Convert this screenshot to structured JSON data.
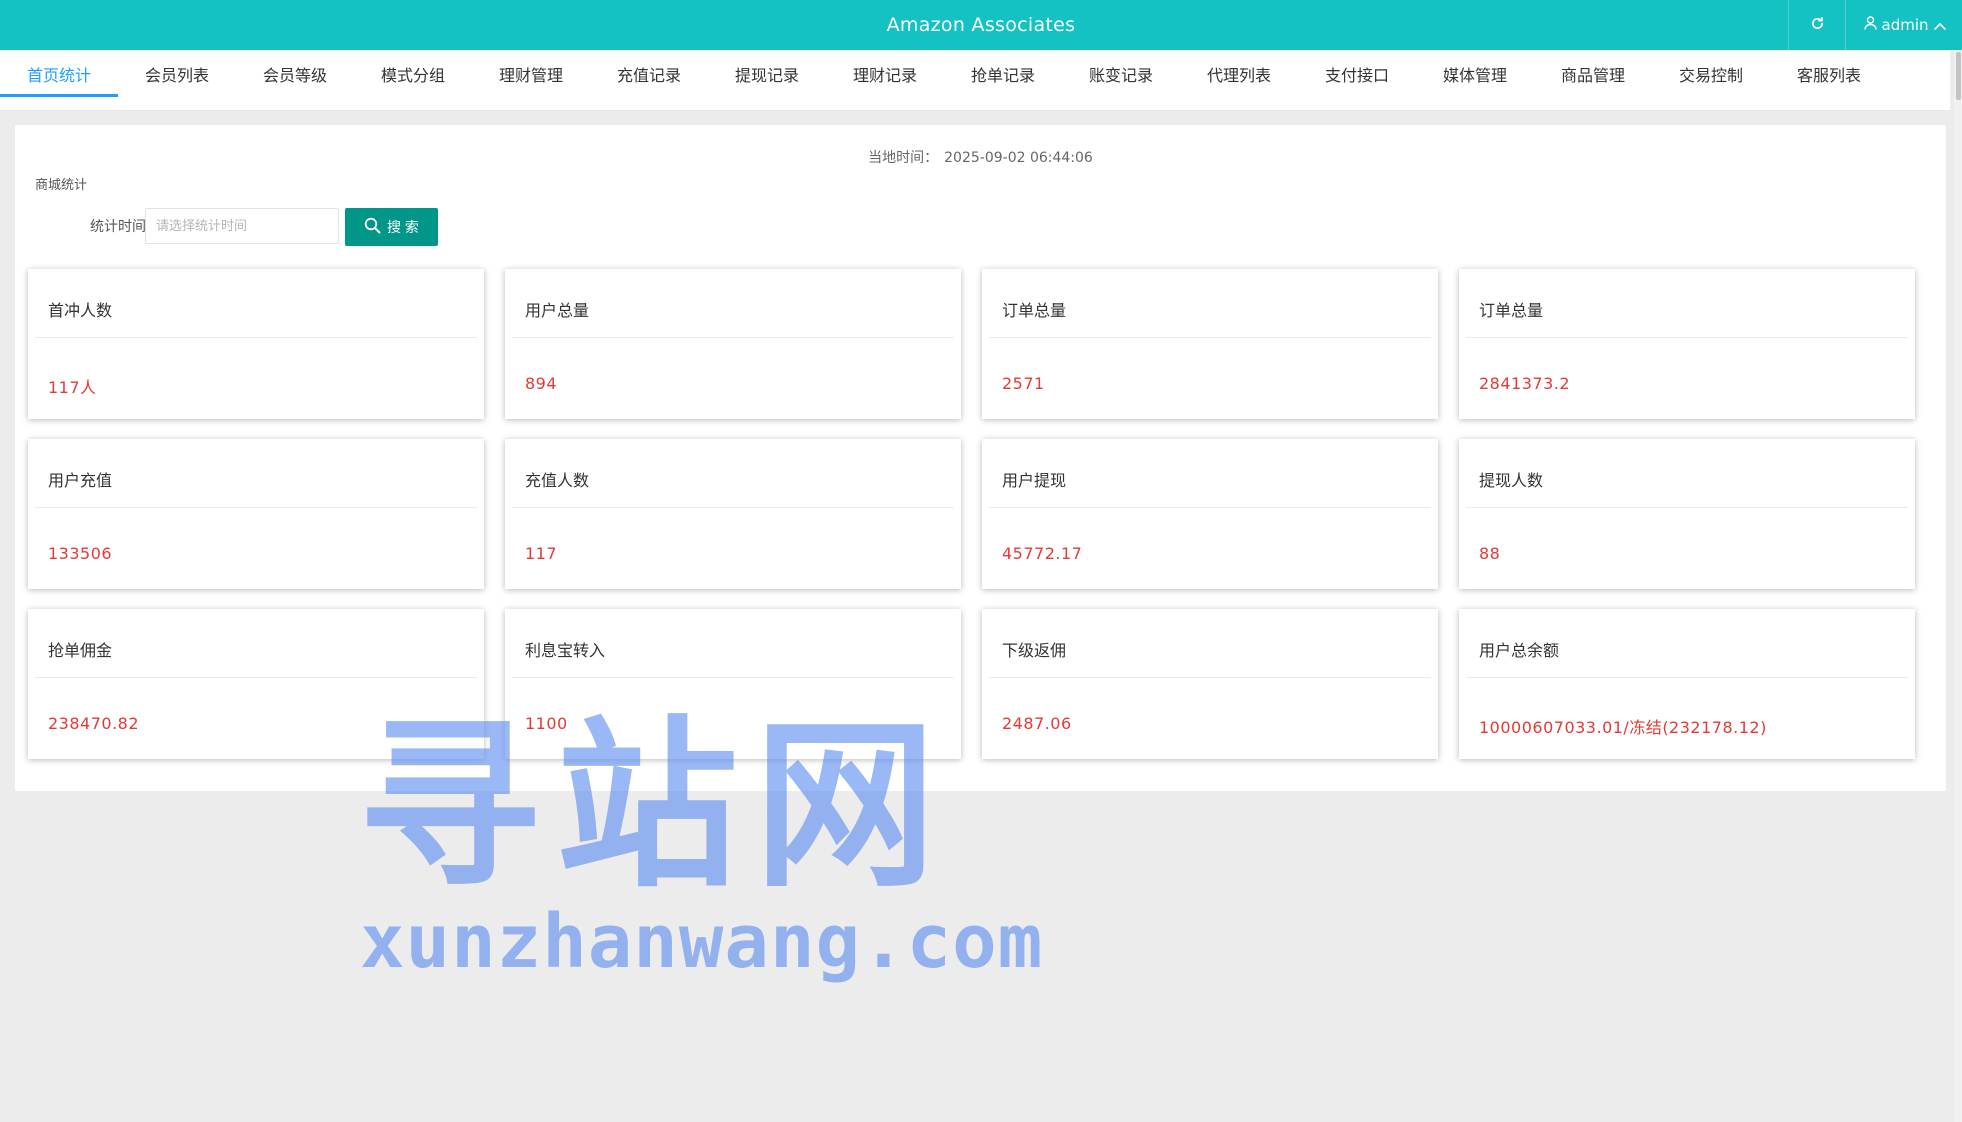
{
  "header": {
    "title": "Amazon Associates",
    "refresh_icon": "refresh-icon",
    "user_icon": "user-icon",
    "user_name": "admin",
    "user_chevron_icon": "chevron-up-icon",
    "background_color": "#14c1c3"
  },
  "nav": {
    "active_index": 0,
    "active_color": "#1e9fff",
    "items": [
      {
        "label": "首页统计"
      },
      {
        "label": "会员列表"
      },
      {
        "label": "会员等级"
      },
      {
        "label": "模式分组"
      },
      {
        "label": "理财管理"
      },
      {
        "label": "充值记录"
      },
      {
        "label": "提现记录"
      },
      {
        "label": "理财记录"
      },
      {
        "label": "抢单记录"
      },
      {
        "label": "账变记录"
      },
      {
        "label": "代理列表"
      },
      {
        "label": "支付接口"
      },
      {
        "label": "媒体管理"
      },
      {
        "label": "商品管理"
      },
      {
        "label": "交易控制"
      },
      {
        "label": "客服列表"
      }
    ]
  },
  "main": {
    "local_time_label": "当地时间：",
    "local_time_value": "2025-09-02 06:44:06",
    "section_title": "商城统计",
    "filter": {
      "label": "统计时间",
      "placeholder": "请选择统计时间",
      "value": ""
    },
    "search_button": {
      "icon": "search-icon",
      "label": "搜 索",
      "color": "#009688"
    },
    "value_color": "#e53935",
    "cards": [
      {
        "label": "首冲人数",
        "value": "117人"
      },
      {
        "label": "用户总量",
        "value": "894"
      },
      {
        "label": "订单总量",
        "value": "2571"
      },
      {
        "label": "订单总量",
        "value": "2841373.2"
      },
      {
        "label": "用户充值",
        "value": "133506"
      },
      {
        "label": "充值人数",
        "value": "117"
      },
      {
        "label": "用户提现",
        "value": "45772.17"
      },
      {
        "label": "提现人数",
        "value": "88"
      },
      {
        "label": "抢单佣金",
        "value": "238470.82"
      },
      {
        "label": "利息宝转入",
        "value": "1100"
      },
      {
        "label": "下级返佣",
        "value": "2487.06"
      },
      {
        "label": "用户总余额",
        "value": "10000607033.01/冻结(232178.12)"
      }
    ]
  },
  "watermark": {
    "line1": "寻站网",
    "line2": "xunzhanwang.com"
  }
}
